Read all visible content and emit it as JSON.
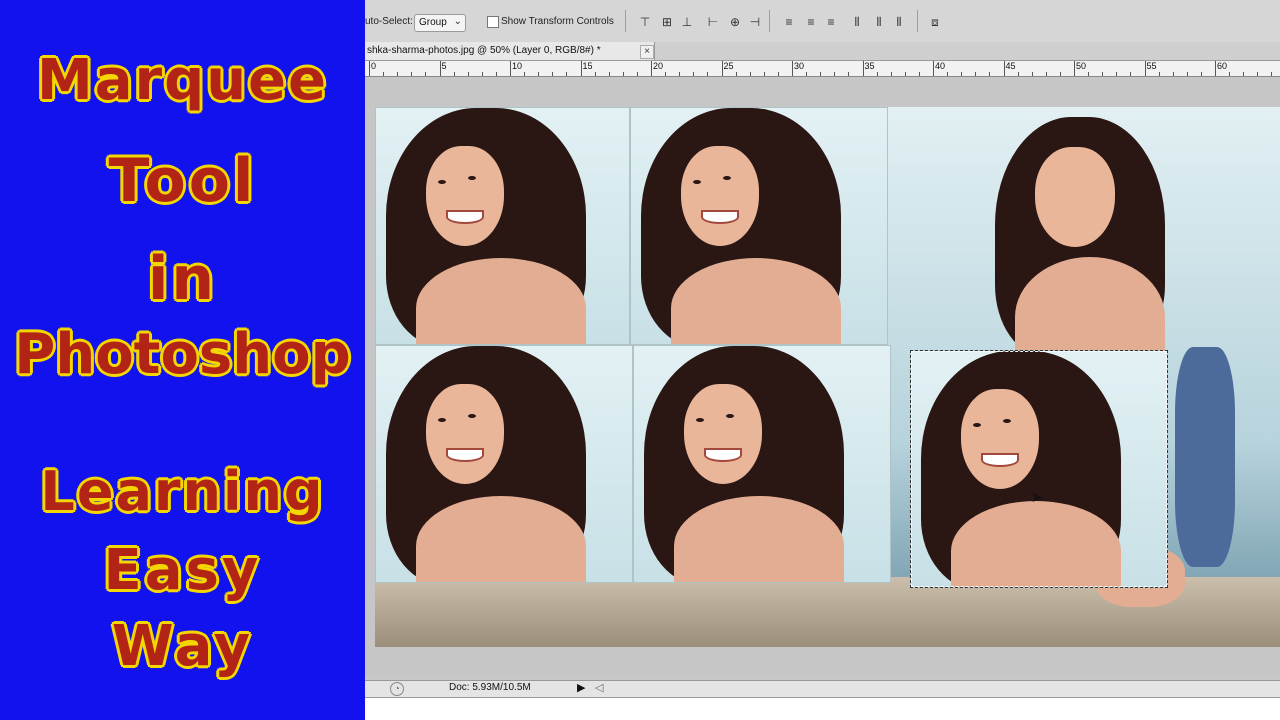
{
  "banner": {
    "lines": [
      "Marquee",
      "Tool",
      "in",
      "Photoshop",
      "Learning",
      "Easy",
      "Way"
    ],
    "bg_color": "#1212ee",
    "text_color": "#b22416",
    "outline_color": "#f4d600"
  },
  "options_bar": {
    "auto_select_label": "uto-Select:",
    "group_value": "Group",
    "show_transform_label": "Show Transform Controls",
    "align_icons": [
      "align-top-icon",
      "align-vcenter-icon",
      "align-bottom-icon",
      "align-left-icon",
      "align-hcenter-icon",
      "align-right-icon",
      "distribute-top-icon",
      "distribute-vcenter-icon",
      "distribute-bottom-icon",
      "distribute-left-icon",
      "distribute-hcenter-icon",
      "distribute-right-icon",
      "auto-align-icon"
    ]
  },
  "document_tab": {
    "title": "shka-sharma-photos.jpg @ 50% (Layer 0, RGB/8#) *",
    "close_symbol": "×"
  },
  "ruler": {
    "labels": [
      "0",
      "5",
      "10",
      "15",
      "20",
      "25",
      "30",
      "35",
      "40",
      "45",
      "50",
      "55",
      "60"
    ]
  },
  "status": {
    "doc_info": "Doc: 5.93M/10.5M",
    "arrow": "▶",
    "scroll_arrow": "◁"
  }
}
